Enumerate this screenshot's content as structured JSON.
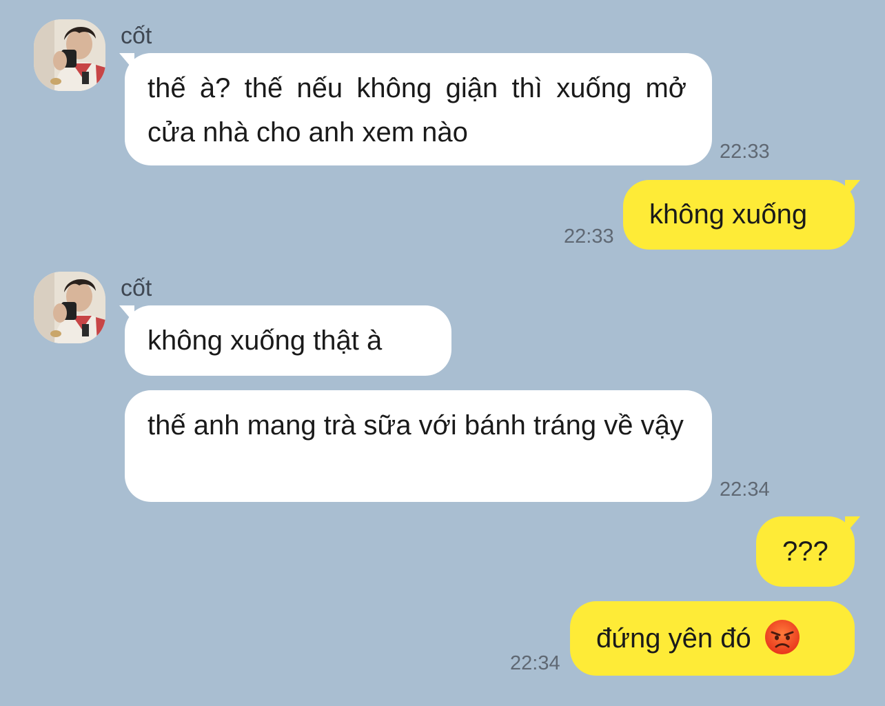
{
  "contact": {
    "name": "cốt"
  },
  "colors": {
    "background": "#a9bed1",
    "incoming_bubble": "#ffffff",
    "outgoing_bubble": "#feeb37"
  },
  "messages": [
    {
      "id": 1,
      "direction": "incoming",
      "text": "thế à? thế nếu không giận thì xuống mở cửa nhà cho anh xem nào",
      "time": "22:33"
    },
    {
      "id": 2,
      "direction": "outgoing",
      "text": "không xuống",
      "time": "22:33"
    },
    {
      "id": 3,
      "direction": "incoming",
      "text": "không xuống thật à",
      "time": ""
    },
    {
      "id": 4,
      "direction": "incoming",
      "text": "thế anh mang trà sữa với bánh tráng về vậy",
      "time": "22:34"
    },
    {
      "id": 5,
      "direction": "outgoing",
      "text": "???",
      "time": ""
    },
    {
      "id": 6,
      "direction": "outgoing",
      "text": "đứng yên đó",
      "emoji": "angry-face-icon",
      "time": "22:34"
    }
  ]
}
